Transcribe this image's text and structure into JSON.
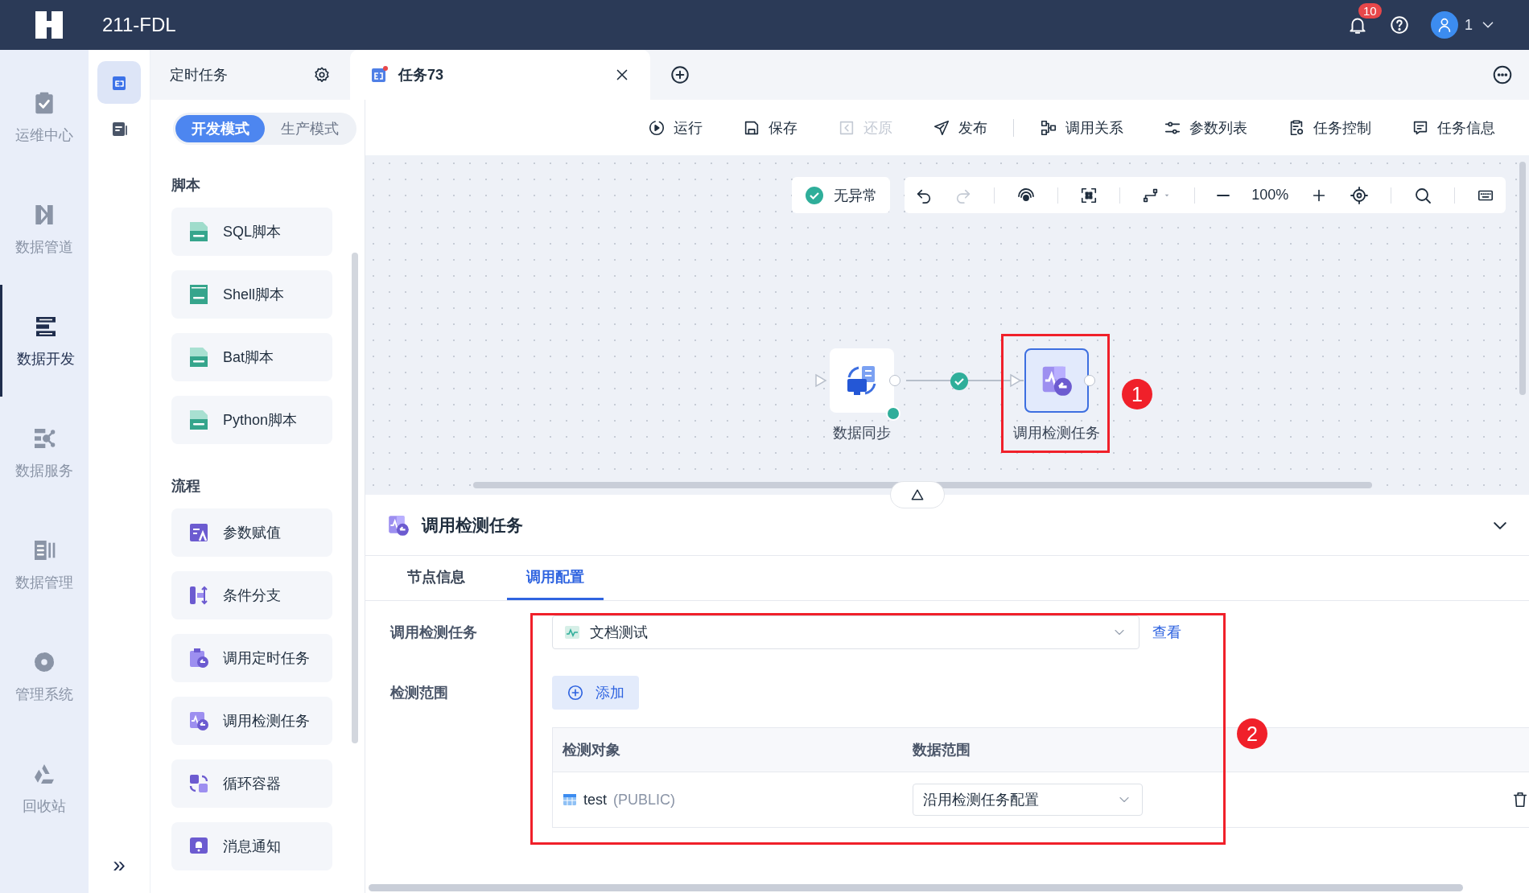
{
  "header": {
    "title": "211-FDL",
    "notification_count": "10",
    "user": "1"
  },
  "nav": [
    {
      "label": "运维中心",
      "selected": false
    },
    {
      "label": "数据管道",
      "selected": false
    },
    {
      "label": "数据开发",
      "selected": true
    },
    {
      "label": "数据服务",
      "selected": false
    },
    {
      "label": "数据管理",
      "selected": false
    },
    {
      "label": "管理系统",
      "selected": false
    },
    {
      "label": "回收站",
      "selected": false
    }
  ],
  "sub_nav": [
    {
      "selected": true
    },
    {
      "selected": false
    }
  ],
  "collapse_toggle": "»",
  "tabs": [
    {
      "label": "定时任务",
      "selected": false
    },
    {
      "label": "任务73",
      "selected": true
    }
  ],
  "mode_switch": [
    {
      "label": "开发模式",
      "selected": true
    },
    {
      "label": "生产模式",
      "selected": false
    }
  ],
  "toolbar": [
    [
      {
        "label": "运行",
        "disabled": false
      },
      {
        "label": "保存",
        "disabled": false
      },
      {
        "label": "还原",
        "disabled": true
      },
      {
        "label": "发布",
        "disabled": false
      }
    ],
    [
      {
        "label": "调用关系",
        "disabled": false
      },
      {
        "label": "参数列表",
        "disabled": false
      },
      {
        "label": "任务控制",
        "disabled": false
      },
      {
        "label": "任务信息",
        "disabled": false
      }
    ]
  ],
  "palette": [
    {
      "title": "脚本",
      "items": [
        "SQL脚本",
        "Shell脚本",
        "Bat脚本",
        "Python脚本"
      ]
    },
    {
      "title": "流程",
      "items": [
        "参数赋值",
        "条件分支",
        "调用定时任务",
        "调用检测任务",
        "循环容器",
        "消息通知"
      ]
    }
  ],
  "canvas": {
    "status": "无异常",
    "zoom": "100%",
    "nodes": [
      {
        "label": "数据同步",
        "selected": false
      },
      {
        "label": "调用检测任务",
        "selected": true
      }
    ]
  },
  "annotations": [
    "1",
    "2"
  ],
  "detail": {
    "title": "调用检测任务",
    "tabs": [
      {
        "label": "节点信息",
        "selected": false
      },
      {
        "label": "调用配置",
        "selected": true
      }
    ],
    "task_label": "调用检测任务",
    "task_value": "文档测试",
    "view_link": "查看",
    "range_label": "检测范围",
    "add_button": "添加",
    "table": {
      "columns": [
        "检测对象",
        "数据范围"
      ],
      "rows": [
        {
          "name": "test",
          "schema": "(PUBLIC)",
          "range": "沿用检测任务配置"
        }
      ]
    }
  }
}
